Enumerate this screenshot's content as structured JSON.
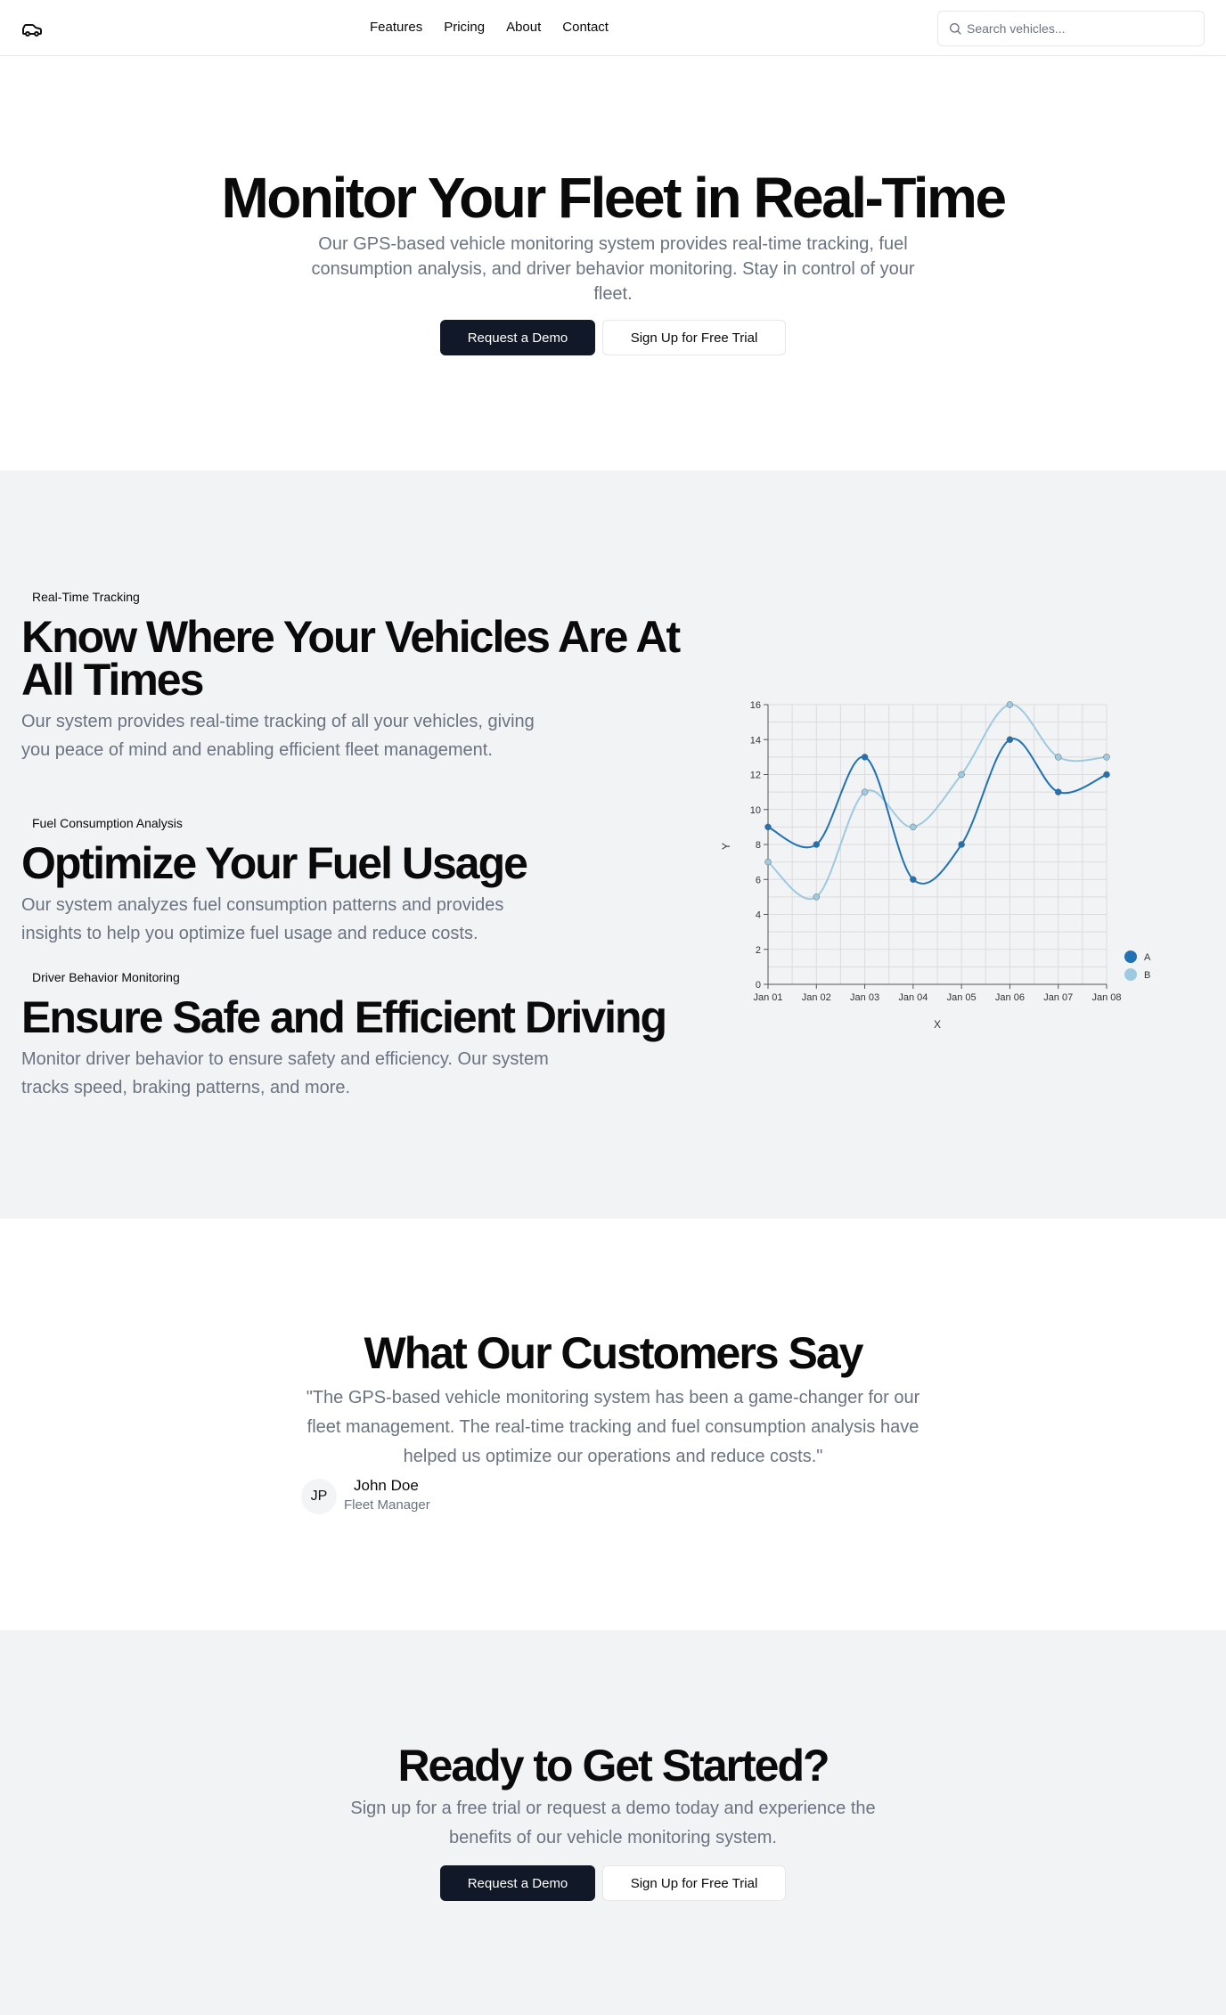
{
  "nav": {
    "links": [
      "Features",
      "Pricing",
      "About",
      "Contact"
    ],
    "search_placeholder": "Search vehicles..."
  },
  "hero": {
    "title": "Monitor Your Fleet in Real-Time",
    "subtitle": "Our GPS-based vehicle monitoring system provides real-time tracking, fuel consumption analysis, and driver behavior monitoring. Stay in control of your fleet.",
    "primary_button": "Request a Demo",
    "secondary_button": "Sign Up for Free Trial"
  },
  "features": [
    {
      "badge": "Real-Time Tracking",
      "title": "Know Where Your Vehicles Are At All Times",
      "text": "Our system provides real-time tracking of all your vehicles, giving you peace of mind and enabling efficient fleet management."
    },
    {
      "badge": "Fuel Consumption Analysis",
      "title": "Optimize Your Fuel Usage",
      "text": "Our system analyzes fuel consumption patterns and provides insights to help you optimize fuel usage and reduce costs."
    },
    {
      "badge": "Driver Behavior Monitoring",
      "title": "Ensure Safe and Efficient Driving",
      "text": "Monitor driver behavior to ensure safety and efficiency. Our system tracks speed, braking patterns, and more."
    }
  ],
  "chart_data": {
    "type": "line",
    "categories": [
      "Jan 01",
      "Jan 02",
      "Jan 03",
      "Jan 04",
      "Jan 05",
      "Jan 06",
      "Jan 07",
      "Jan 08"
    ],
    "series": [
      {
        "name": "A",
        "color": "#2171b5",
        "values": [
          9,
          8,
          13,
          6,
          8,
          14,
          11,
          12
        ]
      },
      {
        "name": "B",
        "color": "#9ecae1",
        "values": [
          7,
          5,
          11,
          9,
          12,
          16,
          13,
          13
        ]
      }
    ],
    "xlabel": "X",
    "ylabel": "Y",
    "ylim": [
      0,
      16
    ],
    "yticks": [
      0,
      2,
      4,
      6,
      8,
      10,
      12,
      14,
      16
    ],
    "grid": true,
    "legend": "bottom-right"
  },
  "testimonial": {
    "title": "What Our Customers Say",
    "quote": "\"The GPS-based vehicle monitoring system has been a game-changer for our fleet management. The real-time tracking and fuel consumption analysis have helped us optimize our operations and reduce costs.\"",
    "avatar_initials": "JP",
    "author_name": "John Doe",
    "author_role": "Fleet Manager"
  },
  "cta": {
    "title": "Ready to Get Started?",
    "text": "Sign up for a free trial or request a demo today and experience the benefits of our vehicle monitoring system.",
    "primary_button": "Request a Demo",
    "secondary_button": "Sign Up for Free Trial"
  }
}
